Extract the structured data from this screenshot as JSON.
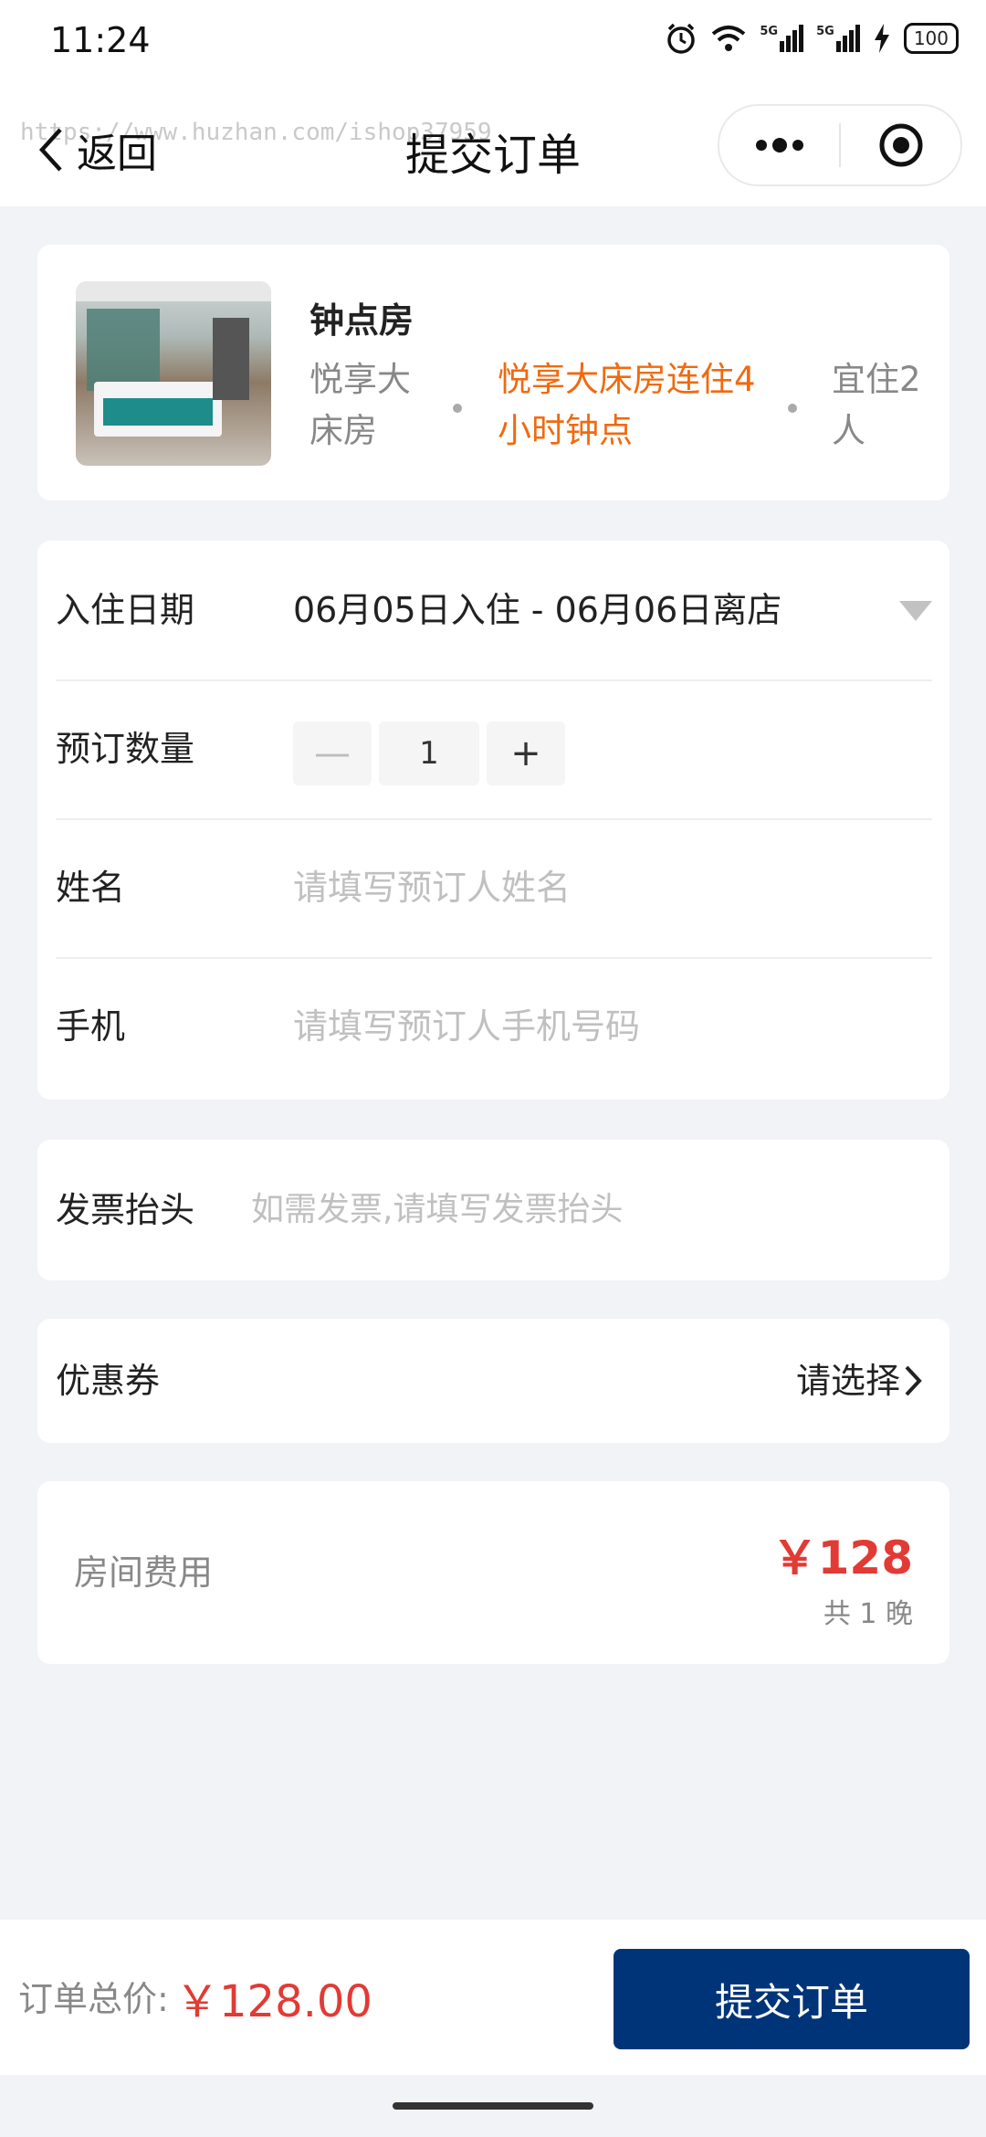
{
  "status": {
    "time": "11:24",
    "battery": "100",
    "signal1": "5G",
    "signal2": "5G"
  },
  "nav": {
    "back_label": "返回",
    "title": "提交订单",
    "watermark": "https://www.huzhan.com/ishop37959"
  },
  "room": {
    "name": "钟点房",
    "tags": [
      "悦享大床房",
      "悦享大床房连住4小时钟点",
      "宜住2人"
    ]
  },
  "form": {
    "checkin_label": "入住日期",
    "checkin_value": "06月05日入住 - 06月06日离店",
    "quantity_label": "预订数量",
    "quantity_minus": "—",
    "quantity_value": "1",
    "quantity_plus": "+",
    "name_label": "姓名",
    "name_placeholder": "请填写预订人姓名",
    "phone_label": "手机",
    "phone_placeholder": "请填写预订人手机号码"
  },
  "invoice": {
    "label": "发票抬头",
    "placeholder": "如需发票,请填写发票抬头"
  },
  "coupon": {
    "label": "优惠券",
    "value": "请选择"
  },
  "fee": {
    "label": "房间费用",
    "amount": "￥128",
    "nights": "共 1 晚"
  },
  "footer": {
    "total_label": "订单总价:",
    "total_value": "￥128.00",
    "submit_label": "提交订单"
  },
  "colors": {
    "accent": "#003478",
    "price": "#e23a35",
    "tag_highlight": "#f06a0f"
  }
}
